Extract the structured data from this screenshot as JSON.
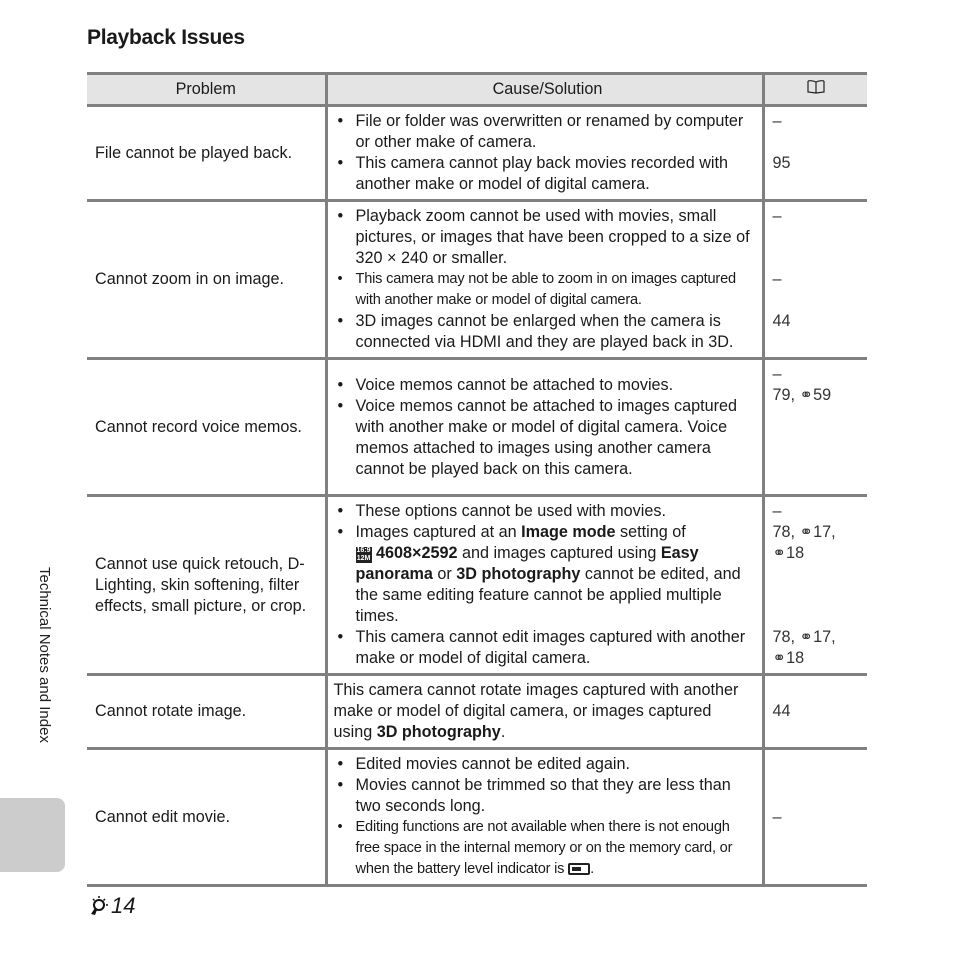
{
  "title": "Playback Issues",
  "table": {
    "headers": {
      "problem": "Problem",
      "cause": "Cause/Solution",
      "ref_icon": "book-icon"
    },
    "rows": [
      {
        "problem": "File cannot be played back.",
        "causes": [
          "File or folder was overwritten or renamed by computer or other make of camera.",
          "This camera cannot play back movies recorded with another make or model of digital camera."
        ],
        "refs": [
          "–",
          "",
          "95",
          ""
        ]
      },
      {
        "problem": "Cannot zoom in on image.",
        "causes": [
          "Playback zoom cannot be used with movies, small pictures, or images that have been cropped to a size of 320 × 240 or smaller.",
          "This camera may not be able to zoom in on images captured with another make or model of digital camera.",
          "3D images cannot be enlarged when the camera is connected via HDMI and they are played back in 3D."
        ],
        "refs": [
          "–",
          "",
          "",
          "–",
          "",
          "44",
          ""
        ]
      },
      {
        "problem": "Cannot record voice memos.",
        "causes": [
          "Voice memos cannot be attached to movies.",
          "Voice memos cannot be attached to images captured with another make or model of digital camera. Voice memos attached to images using another camera cannot be played back on this camera."
        ],
        "refs": [
          "–",
          "79, ⚭59"
        ]
      },
      {
        "problem": "Cannot use quick retouch, D-Lighting, skin softening, filter effects, small picture, or crop.",
        "causes_rich": {
          "c1": "These options cannot be used with movies.",
          "c2_a": "Images captured at an ",
          "c2_b": "Image mode",
          "c2_c": " setting of ",
          "c2_icon": "16:9 12M",
          "c2_d": " 4608×2592",
          "c2_e": " and images captured using ",
          "c2_f": "Easy panorama",
          "c2_g": " or ",
          "c2_h": "3D photography",
          "c2_i": " cannot be edited, and the same editing feature cannot be applied multiple times.",
          "c3": "This camera cannot edit images captured with another make or model of digital camera."
        },
        "refs": [
          "–",
          "78, ⚭17,",
          "⚭18",
          "",
          "",
          "",
          "78, ⚭17,",
          "⚭18"
        ]
      },
      {
        "problem": "Cannot rotate image.",
        "cause_rich": {
          "a": "This camera cannot rotate images captured with another make or model of digital camera, or images captured using ",
          "b": "3D photography",
          "c": "."
        },
        "refs": [
          "44"
        ]
      },
      {
        "problem": "Cannot edit movie.",
        "causes": [
          "Edited movies cannot be edited again.",
          "Movies cannot be trimmed so that they are less than two seconds long.",
          "Editing functions are not available when there is not enough free space in the internal memory or on the memory card, or when the battery level indicator is "
        ],
        "battery_icon": "battery-low-icon",
        "cause_end": ".",
        "refs": [
          "–"
        ]
      }
    ]
  },
  "side_label": "Technical Notes and Index",
  "footer": {
    "icon": "tip-bulb-icon",
    "page": "14"
  }
}
